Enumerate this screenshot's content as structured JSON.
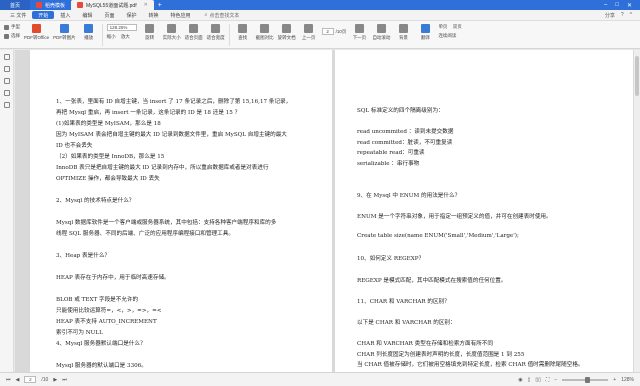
{
  "tabs": {
    "home": "首页",
    "items": [
      {
        "label": "稻壳模板",
        "color": "#e84a3a"
      },
      {
        "label": "MySQL55道面试题.pdf",
        "color": "#e84a3a"
      }
    ]
  },
  "menu": {
    "items": [
      "三 文件",
      "开始",
      "插入",
      "编辑",
      "页面",
      "保护",
      "转换",
      "特色应用"
    ],
    "active_index": 1,
    "search": "点击查找文本",
    "right": [
      "分享",
      "?",
      "^"
    ]
  },
  "toolbar": {
    "tools": [
      {
        "label": "PDF转Office",
        "color": "#e14b2e"
      },
      {
        "label": "PDF转图片",
        "color": "#3b7bd8"
      },
      {
        "label": "播放",
        "color": "#3b7bd8"
      }
    ],
    "small_left": [
      "手型",
      "选择"
    ],
    "zoom": "128.25%",
    "small_mid": [
      "缩小",
      "放大"
    ],
    "tools2": [
      {
        "label": "旋转",
        "color": "#6a6a6a"
      },
      {
        "label": "实际大小",
        "color": "#6a6a6a"
      },
      {
        "label": "适合页面",
        "color": "#6a6a6a"
      },
      {
        "label": "适合宽度",
        "color": "#6a6a6a"
      }
    ],
    "tools3": [
      {
        "label": "查找",
        "color": "#6a6a6a"
      },
      {
        "label": "截图对比",
        "color": "#6a6a6a"
      },
      {
        "label": "旋转文档",
        "color": "#6a6a6a"
      },
      {
        "label": "上一页",
        "color": "#6a6a6a"
      }
    ],
    "page_current": "2",
    "page_total": "/10页",
    "tools4": [
      {
        "label": "下一页",
        "color": "#6a6a6a"
      },
      {
        "label": "自动滚动",
        "color": "#6a6a6a"
      },
      {
        "label": "背景",
        "color": "#6a6a6a"
      },
      {
        "label": "翻译",
        "color": "#3b7bd8"
      }
    ],
    "small_right": [
      "单页",
      "双页",
      "连续阅读",
      "阅读模式"
    ]
  },
  "doc": {
    "left_lines": [
      "1、一张表，里面有 ID 自增主键，当 insert 了 17 条记录之后，删除了第 15,16,17 条记录，",
      "再把 Mysql 重启，再 insert 一条记录，这条记录的 ID 是 18 还是 15 ？",
      "(1)如果表的类型是 MyISAM，那么是 18",
      "因为 MyISAM 表会把自增主键的最大 ID 记录到数据文件里，重启 MySQL 自增主键的最大",
      "ID 也不会丢失",
      "（2）如果表的类型是 InnoDB，那么是 15",
      "InnoDB 表只是把自增主键的最大 ID 记录到内存中，所以重启数据库或者是对表进行",
      "OPTIMIZE 操作，都会导致最大 ID 丢失",
      "",
      "2、Mysql 的技术特点是什么？",
      "",
      "Mysql 数据库软件是一个客户端或服务器系统，其中包括：支持各种客户端程序和库的多",
      "线程 SQL 服务器、不同的后端、广泛的应用程序编程接口和管理工具。",
      "",
      "3、Heap 表是什么？",
      "",
      "HEAP 表存在于内存中，用于临时高速存储。",
      "",
      "BLOB 或 TEXT 字段是不允许的",
      "只能使用比较运算符=，<，>，=>，=<",
      "HEAP 表不支持 AUTO_INCREMENT",
      "索引不可为 NULL",
      "4、Mysql 服务器默认端口是什么？",
      "",
      "Mysql 服务器的默认端口是 3306。",
      "",
      "5、与 Oracle 相比，Mysql 有什么优势？"
    ],
    "right_lines": [
      "SQL 标准定义的四个隔离级别为：",
      "",
      "read uncommited ：读到未提交数据",
      "read committed：脏读，不可重复读",
      "repeatable read：可重读",
      "serializable ：串行事物",
      "",
      "",
      "9、在 Mysql 中 ENUM 的用法是什么？",
      "",
      "ENUM 是一个字符串对象，用于指定一组预定义的值，并可在创建表时使用。",
      "",
      "Create table size(name ENUM('Small','Medium','Large');",
      "",
      "10、如何定义 REGEXP？",
      "",
      "REGEXP 是模式匹配，其中匹配模式在搜索值的任何位置。",
      "",
      "11、CHAR 和 VARCHAR 的区别？",
      "",
      "以下是 CHAR 和 VARCHAR 的区别：",
      "",
      "CHAR 和 VARCHAR 类型在存储和检索方面有所不同",
      "CHAR 列长度固定为创建表时声明的长度，长度值范围是 1 到 255",
      "当 CHAR 值被存储时，它们被用空格填充到特定长度，检索 CHAR 值时需删除尾随空格。"
    ]
  },
  "status": {
    "page_current": "2",
    "page_total": "/10",
    "zoom": "128%",
    "zoom_fraction": 0.55
  }
}
